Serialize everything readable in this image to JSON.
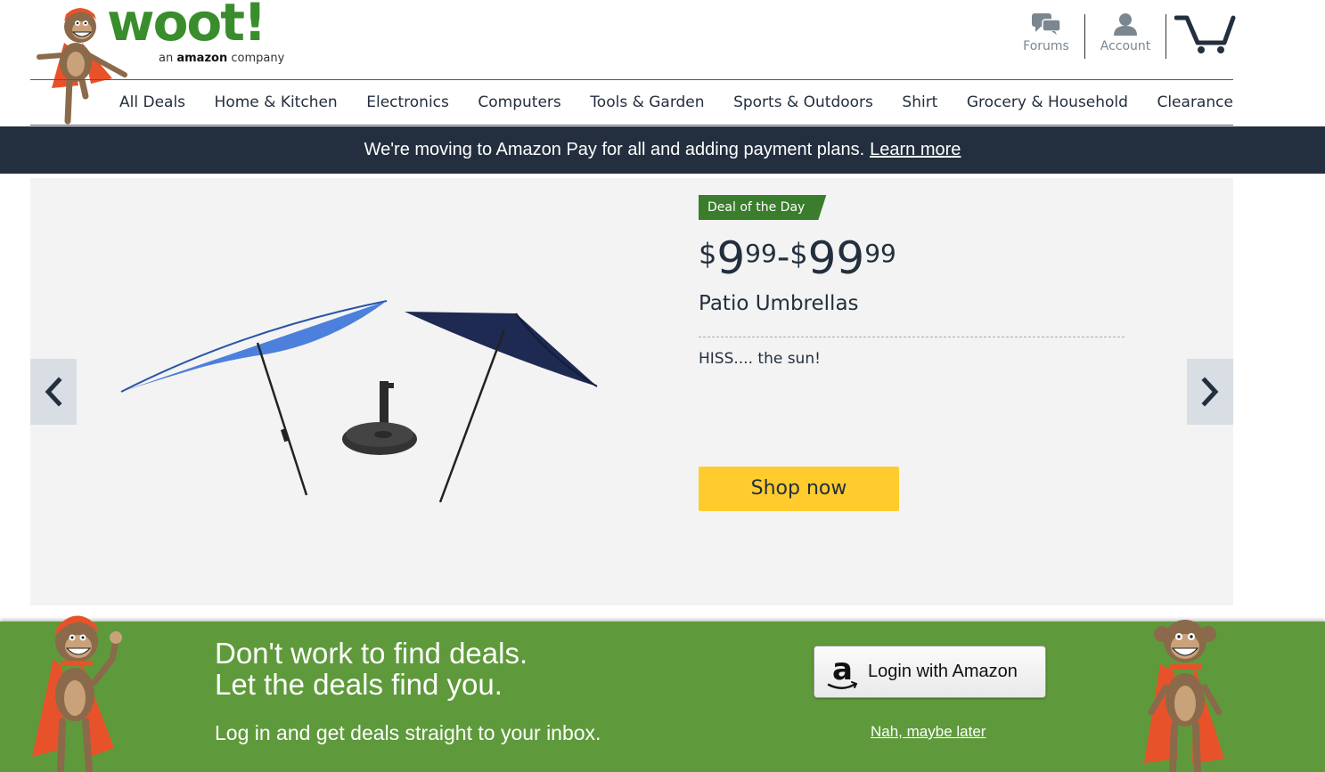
{
  "header": {
    "logo_word": "woot!",
    "logo_tagline_prefix": "an",
    "logo_tagline_brand": "amazon",
    "logo_tagline_suffix": "company",
    "forums_label": "Forums",
    "account_label": "Account"
  },
  "nav": {
    "items": [
      {
        "label": "All Deals"
      },
      {
        "label": "Home & Kitchen"
      },
      {
        "label": "Electronics"
      },
      {
        "label": "Computers"
      },
      {
        "label": "Tools & Garden"
      },
      {
        "label": "Sports & Outdoors"
      },
      {
        "label": "Shirt"
      },
      {
        "label": "Grocery & Household"
      },
      {
        "label": "Clearance"
      }
    ]
  },
  "banner": {
    "text": "We're moving to Amazon Pay for all and adding payment plans.",
    "link": "Learn more"
  },
  "deal": {
    "badge": "Deal of the Day",
    "price_low_currency": "$",
    "price_low_dollars": "9",
    "price_low_cents": "99",
    "price_separator": "-",
    "price_high_currency": "$",
    "price_high_dollars": "99",
    "price_high_cents": "99",
    "title": "Patio Umbrellas",
    "tagline": "HISS.... the sun!",
    "cta": "Shop now"
  },
  "promo": {
    "headline_1": "Don't work to find deals.",
    "headline_2": "Let the deals find you.",
    "subtext": "Log in and get deals straight to your inbox.",
    "login_button": "Login with Amazon",
    "later_link": "Nah, maybe later"
  },
  "colors": {
    "brand_green": "#3a8d2c",
    "banner_bg": "#232f3e",
    "promo_bg": "#5e9a3b",
    "cta_yellow": "#ffcb2d",
    "hero_bg": "#f3f3f3"
  }
}
